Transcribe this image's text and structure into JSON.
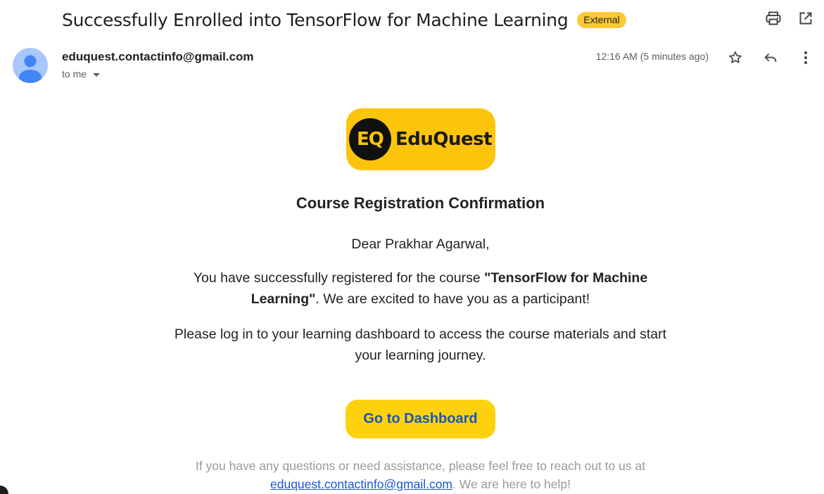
{
  "email": {
    "subject": "Successfully Enrolled into TensorFlow for Machine Learning",
    "badge": "External",
    "sender": "eduquest.contactinfo@gmail.com",
    "recipient_label": "to me",
    "timestamp": "12:16 AM (5 minutes ago)"
  },
  "icons": {
    "print": "print-icon",
    "open_new_window": "open-in-new-window-icon",
    "star": "star-icon",
    "reply": "reply-icon",
    "more": "more-vert-icon",
    "avatar": "avatar-icon",
    "dropdown": "chevron-down-icon"
  },
  "body": {
    "logo": {
      "monogram": "EQ",
      "name": "EduQuest"
    },
    "heading": "Course Registration Confirmation",
    "greeting": "Dear Prakhar Agarwal,",
    "paragraph1": {
      "before": "You have successfully registered for the course ",
      "course": "\"TensorFlow for Machine Learning\"",
      "after": ". We are excited to have you as a participant!"
    },
    "paragraph2": "Please log in to your learning dashboard to access the course materials and start your learning journey.",
    "cta_label": "Go to Dashboard",
    "footer": {
      "before": "If you have any questions or need assistance, please feel free to reach out to us at ",
      "email": "eduquest.contactinfo@gmail.com",
      "after": ". We are here to help!"
    }
  },
  "colors": {
    "badge_bg": "#fcc934",
    "logo_bg": "#fdc40c",
    "cta_bg": "#fdd10d",
    "cta_text": "#1a56b0",
    "link": "#1a56d6",
    "avatar_bg": "#a8c7fa",
    "avatar_fg": "#4285f4"
  }
}
